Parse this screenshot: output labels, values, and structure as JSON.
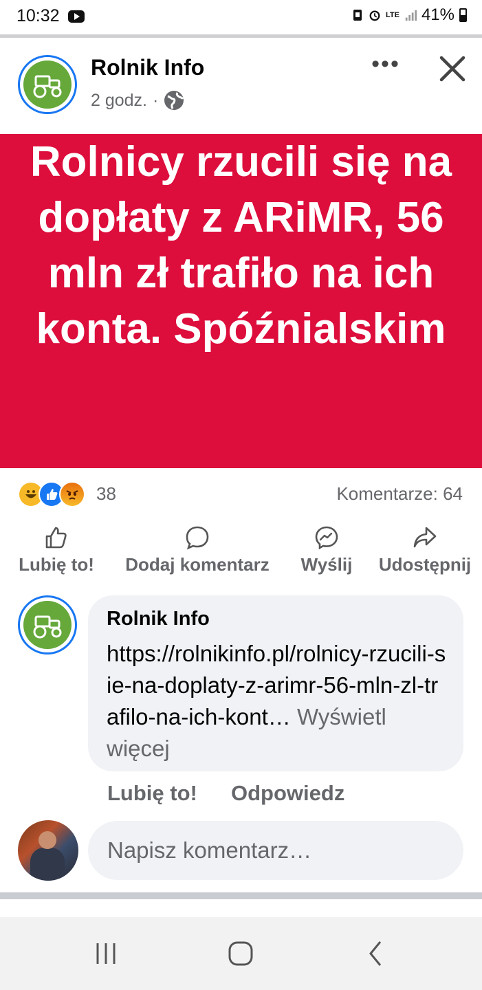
{
  "status_bar": {
    "time": "10:32",
    "lte": "LTE",
    "battery": "41%"
  },
  "post": {
    "page_name": "Rolnik Info",
    "time_ago": "2 godz.",
    "separator": "·",
    "more_label": "•••",
    "banner_text": "Rolnicy rzucili się na dopłaty z ARiMR, 56 mln zł trafiło na ich konta. Spóźnialskim",
    "banner_color": "#dd0d3c",
    "reaction_count": "38",
    "comments_label": "Komentarze: 64",
    "reactions": [
      "haha",
      "like",
      "angry"
    ]
  },
  "actions": {
    "like": "Lubię to!",
    "comment": "Dodaj komentarz",
    "send": "Wyślij",
    "share": "Udostępnij"
  },
  "comment": {
    "author": "Rolnik Info",
    "text": "https://rolnikinfo.pl/rolnicy-rzucili-sie-na-doplaty-z-arimr-56-mln-zl-trafilo-na-ich-kont…",
    "see_more": "Wyświetl więcej",
    "like_label": "Lubię to!",
    "reply_label": "Odpowiedz"
  },
  "composer": {
    "placeholder": "Napisz komentarz…"
  },
  "colors": {
    "accent": "#1877f2",
    "secondary_text": "#65676b"
  }
}
